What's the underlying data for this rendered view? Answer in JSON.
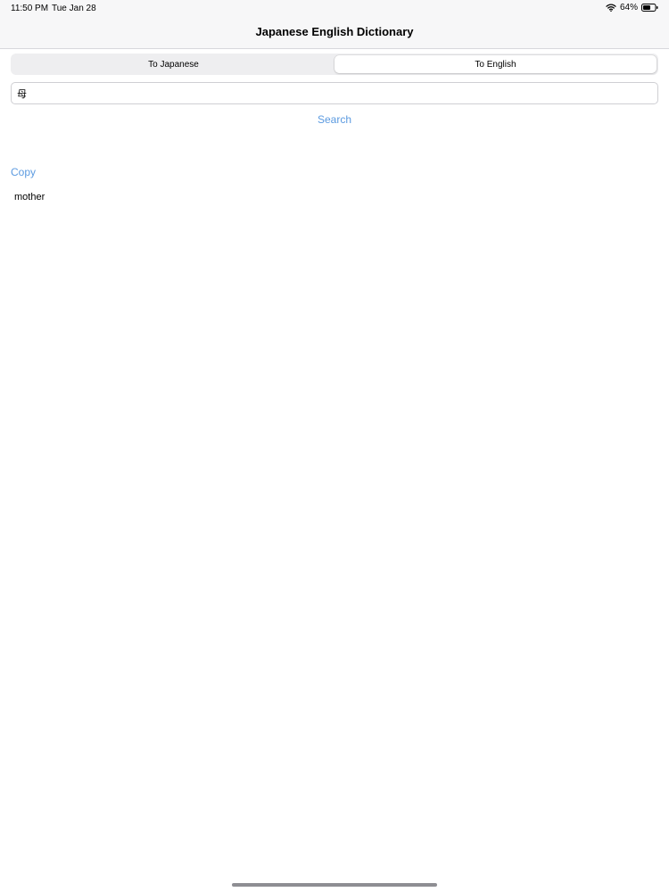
{
  "status_bar": {
    "time": "11:50 PM",
    "date": "Tue Jan 28",
    "battery": "64%",
    "battery_level": 0.64,
    "icons": [
      "wifi-icon",
      "battery-icon"
    ]
  },
  "nav": {
    "title": "Japanese English Dictionary"
  },
  "mode_selector": {
    "options": [
      {
        "label": "To Japanese",
        "selected": false
      },
      {
        "label": "To English",
        "selected": true
      }
    ]
  },
  "search": {
    "value": "母",
    "button_label": "Search"
  },
  "result": {
    "copy_label": "Copy",
    "text": "mother"
  },
  "colors": {
    "accent": "#5b9ae0",
    "header_background": "#f7f7f8",
    "segment_background": "#eeeef0"
  }
}
